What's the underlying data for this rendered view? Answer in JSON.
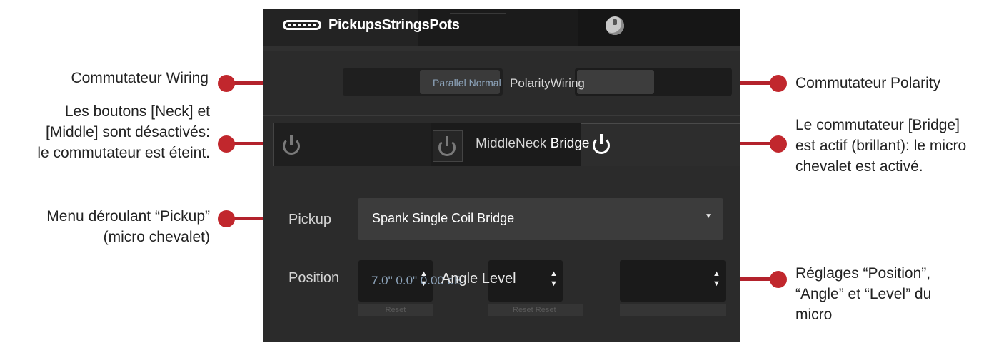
{
  "tabs": {
    "pickups": "Pickups",
    "strings": "Strings",
    "pots": "Pots",
    "pickups_icon": "pickup-icon",
    "pots_icon": "knob-icon"
  },
  "wiring_switch": {
    "label": "Wiring",
    "options_text": "Parallel Normal"
  },
  "polarity_switch": {
    "label": "Polarity"
  },
  "pickup_buttons": {
    "middle": "Middle",
    "neck": "Neck",
    "bridge": "Bridge",
    "neck_state": "off",
    "middle_state": "off",
    "bridge_state": "on"
  },
  "pickup_row": {
    "label": "Pickup",
    "selected": "Spank Single Coil Bridge"
  },
  "position_row": {
    "label": "Position",
    "values_text": "7.0\" 0.0\" 0.00 dB",
    "angle_label": "Angle",
    "level_label": "Level",
    "reset": "Reset",
    "reset_double": "Reset Reset"
  },
  "callouts": {
    "wiring": "Commutateur Wiring",
    "neck_middle": [
      "Les boutons [Neck] et",
      "[Middle] sont désactivés:",
      "le commutateur est éteint."
    ],
    "pickup_menu": [
      "Menu déroulant “Pickup”",
      "(micro chevalet)"
    ],
    "polarity": "Commutateur Polarity",
    "bridge": [
      "Le commutateur [Bridge]",
      "est actif (brillant): le micro",
      "chevalet est activé."
    ],
    "settings": [
      "Réglages “Position”,",
      "“Angle” et “Level” du",
      "micro"
    ]
  },
  "colors": {
    "callout_red": "#c1272d",
    "panel_bg": "#2b2b2b",
    "value_blue": "#8fa6bd"
  }
}
